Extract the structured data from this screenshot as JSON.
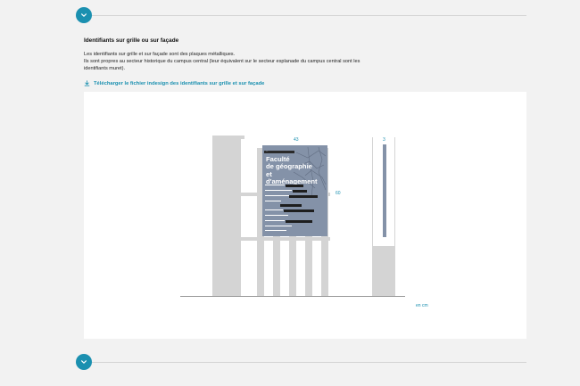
{
  "section": {
    "heading": "Identifiants sur grille ou sur façade",
    "description_line1": "Les identifiants sur grille et sur façade sont des plaques métalliques.",
    "description_line2": "Ils sont propres au secteur historique du campus central (leur équivalent sur le secteur esplanade du campus central sont les identifiants muret).",
    "download_label": "Télécharger le fichier indesign des identifiants sur grille et sur façade"
  },
  "illustration": {
    "sign_title_line1": "Faculté",
    "sign_title_line2": "de géographie",
    "sign_title_line3": "et d'aménagement",
    "dim_width": "43",
    "dim_height": "60",
    "dim_small": "3",
    "unit": "en cm"
  },
  "colors": {
    "accent": "#1b90b0",
    "sign": "#8492a8",
    "structure": "#d4d4d4"
  },
  "icons": {
    "top_toggle": "chevron-down-icon",
    "bottom_toggle": "chevron-down-icon",
    "download": "download-icon"
  }
}
